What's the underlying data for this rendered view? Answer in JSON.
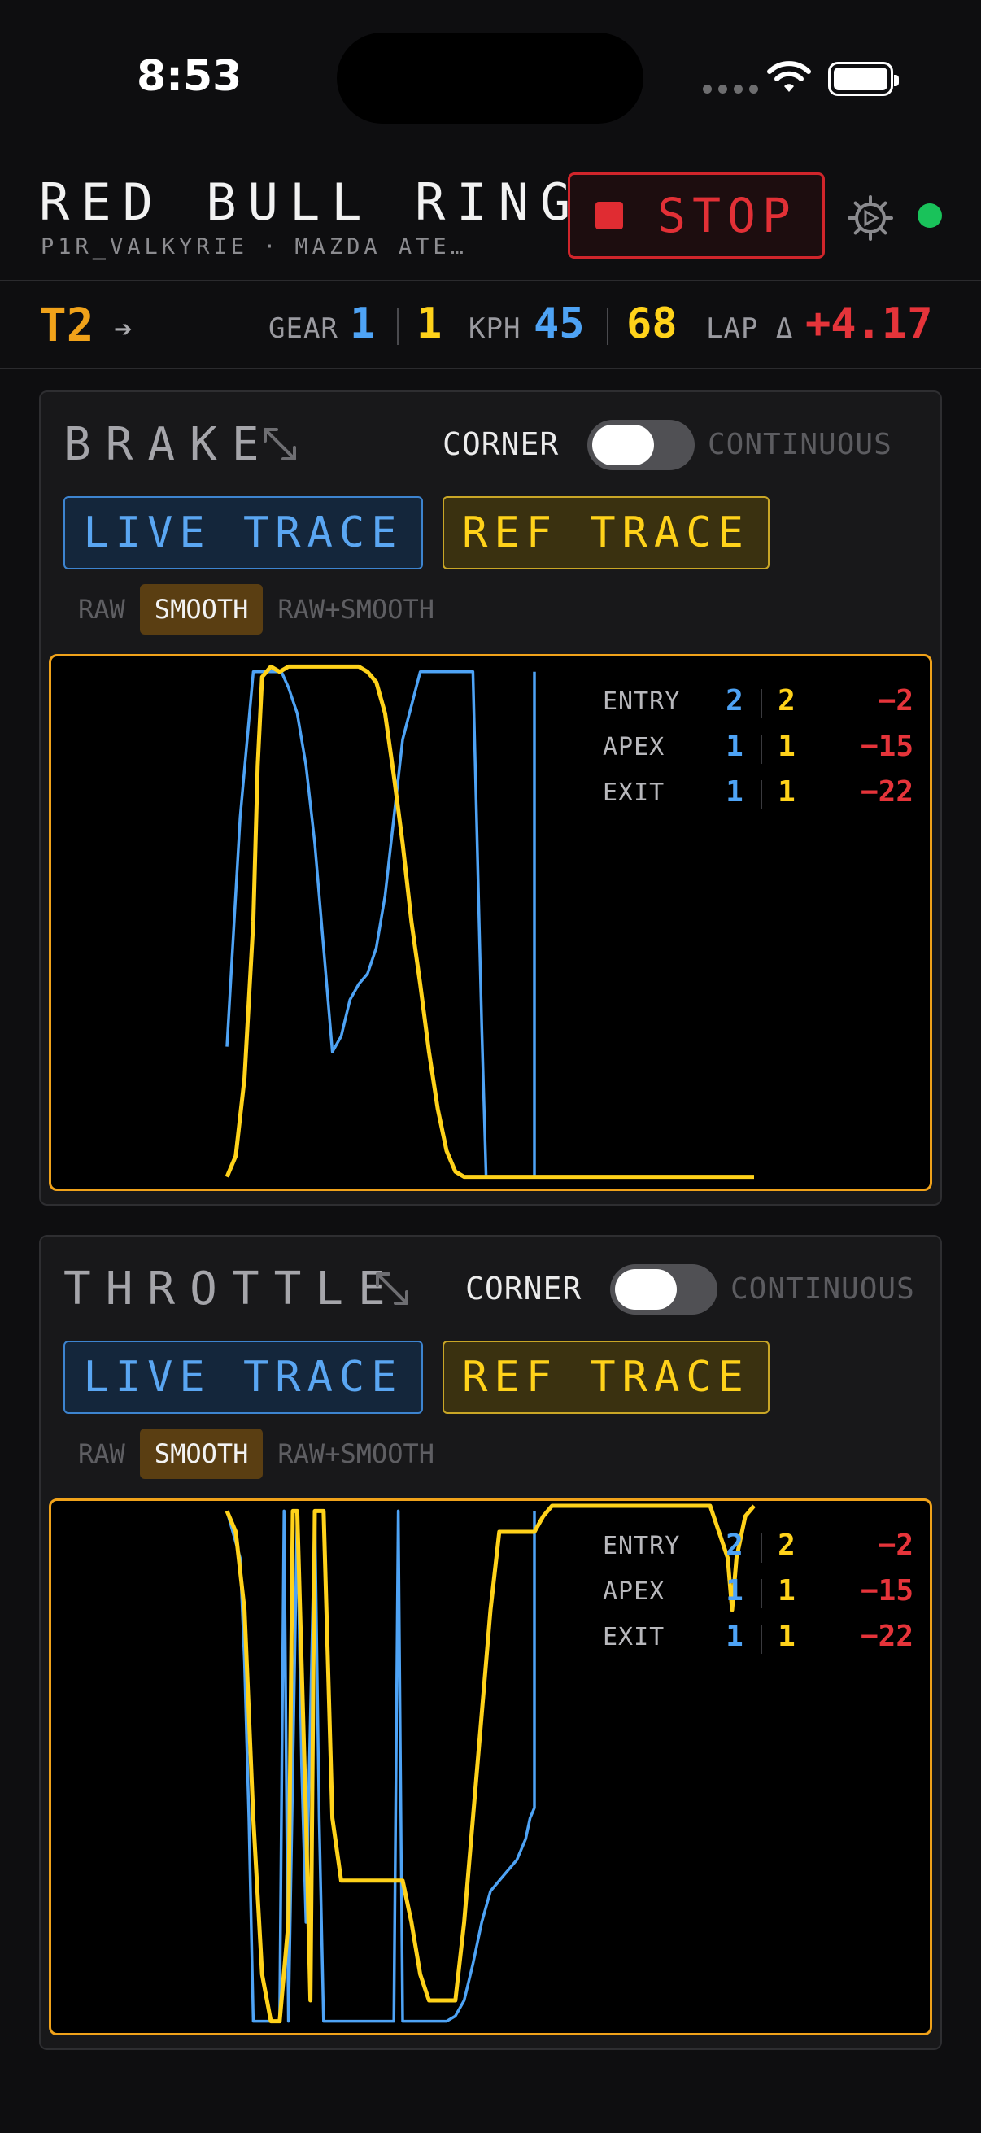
{
  "status": {
    "time": "8:53"
  },
  "header": {
    "track": "RED BULL RING",
    "driver": "P1R_VALKYRIE",
    "separator": "·",
    "car": "MAZDA ATE…",
    "stop_label": "STOP"
  },
  "telemetry": {
    "turn": "T2",
    "turn_arrow": "➔",
    "gear_label": "GEAR",
    "gear_live": "1",
    "gear_ref": "1",
    "kph_label": "KPH",
    "kph_live": "45",
    "kph_ref": "68",
    "lap_label": "LAP Δ",
    "lap_delta": "+4.17"
  },
  "colors": {
    "live": "#4ea3f5",
    "ref": "#ffd21a",
    "delta": "#e5343a",
    "accent": "#f0a21a",
    "connected": "#19c25a"
  },
  "panels": [
    {
      "title": "BRAKE",
      "mode_corner": "CORNER",
      "mode_continuous": "CONTINUOUS",
      "live_trace": "LIVE TRACE",
      "ref_trace": "REF TRACE",
      "smoothing": {
        "options": [
          "RAW",
          "SMOOTH",
          "RAW+SMOOTH"
        ],
        "selected": "SMOOTH"
      },
      "summary": [
        {
          "name": "ENTRY",
          "live": "2",
          "ref": "2",
          "delta": "−2"
        },
        {
          "name": "APEX",
          "live": "1",
          "ref": "1",
          "delta": "−15"
        },
        {
          "name": "EXIT",
          "live": "1",
          "ref": "1",
          "delta": "−22"
        }
      ]
    },
    {
      "title": "THROTTLE",
      "mode_corner": "CORNER",
      "mode_continuous": "CONTINUOUS",
      "live_trace": "LIVE TRACE",
      "ref_trace": "REF TRACE",
      "smoothing": {
        "options": [
          "RAW",
          "SMOOTH",
          "RAW+SMOOTH"
        ],
        "selected": "SMOOTH"
      },
      "summary": [
        {
          "name": "ENTRY",
          "live": "2",
          "ref": "2",
          "delta": "−2"
        },
        {
          "name": "APEX",
          "live": "1",
          "ref": "1",
          "delta": "−15"
        },
        {
          "name": "EXIT",
          "live": "1",
          "ref": "1",
          "delta": "−22"
        }
      ]
    }
  ],
  "chart_data": [
    {
      "type": "line",
      "xlim": [
        0,
        1
      ],
      "ylim": [
        0,
        1
      ],
      "series": [
        {
          "x": [
            0.2,
            0.215,
            0.23,
            0.24,
            0.25,
            0.26,
            0.262,
            0.27,
            0.28,
            0.29,
            0.3,
            0.31,
            0.32,
            0.33,
            0.34,
            0.35,
            0.36,
            0.37,
            0.38,
            0.39,
            0.4,
            0.42,
            0.43,
            0.44,
            0.45,
            0.46,
            0.47,
            0.48,
            0.49,
            0.495,
            0.51,
            0.53,
            0.55,
            0.55
          ],
          "y": [
            0.26,
            0.7,
            0.98,
            0.98,
            0.98,
            0.98,
            0.98,
            0.95,
            0.9,
            0.8,
            0.65,
            0.45,
            0.25,
            0.28,
            0.35,
            0.38,
            0.4,
            0.45,
            0.55,
            0.7,
            0.85,
            0.98,
            0.98,
            0.98,
            0.98,
            0.98,
            0.98,
            0.98,
            0.3,
            0.01,
            0.01,
            0.01,
            0.01,
            0.98
          ]
        },
        {
          "x": [
            0.2,
            0.21,
            0.22,
            0.23,
            0.235,
            0.24,
            0.25,
            0.26,
            0.27,
            0.28,
            0.3,
            0.32,
            0.34,
            0.35,
            0.36,
            0.37,
            0.38,
            0.39,
            0.4,
            0.41,
            0.42,
            0.43,
            0.44,
            0.45,
            0.46,
            0.47,
            0.48,
            0.49,
            0.5,
            0.55,
            0.65,
            0.8
          ],
          "y": [
            0.01,
            0.05,
            0.2,
            0.5,
            0.8,
            0.97,
            0.99,
            0.98,
            0.99,
            0.99,
            0.99,
            0.99,
            0.99,
            0.99,
            0.98,
            0.96,
            0.9,
            0.78,
            0.65,
            0.5,
            0.38,
            0.25,
            0.14,
            0.06,
            0.02,
            0.01,
            0.01,
            0.01,
            0.01,
            0.01,
            0.01,
            0.01
          ]
        }
      ]
    },
    {
      "type": "line",
      "xlim": [
        0,
        1
      ],
      "ylim": [
        0,
        1
      ],
      "series": [
        {
          "x": [
            0.2,
            0.215,
            0.22,
            0.225,
            0.23,
            0.26,
            0.265,
            0.27,
            0.28,
            0.285,
            0.29,
            0.3,
            0.305,
            0.31,
            0.39,
            0.395,
            0.4,
            0.41,
            0.42,
            0.43,
            0.44,
            0.45,
            0.46,
            0.47,
            0.48,
            0.49,
            0.5,
            0.51,
            0.52,
            0.53,
            0.54,
            0.545,
            0.55,
            0.55
          ],
          "y": [
            0.99,
            0.9,
            0.7,
            0.4,
            0.01,
            0.01,
            0.99,
            0.01,
            0.99,
            0.5,
            0.2,
            0.99,
            0.4,
            0.01,
            0.01,
            0.99,
            0.01,
            0.01,
            0.01,
            0.01,
            0.01,
            0.01,
            0.02,
            0.05,
            0.12,
            0.2,
            0.26,
            0.28,
            0.3,
            0.32,
            0.36,
            0.4,
            0.42,
            0.99
          ]
        },
        {
          "x": [
            0.2,
            0.21,
            0.22,
            0.23,
            0.24,
            0.25,
            0.26,
            0.27,
            0.275,
            0.28,
            0.29,
            0.295,
            0.3,
            0.31,
            0.32,
            0.33,
            0.34,
            0.35,
            0.36,
            0.37,
            0.38,
            0.39,
            0.4,
            0.41,
            0.42,
            0.43,
            0.44,
            0.45,
            0.46,
            0.47,
            0.48,
            0.49,
            0.5,
            0.51,
            0.52,
            0.53,
            0.54,
            0.55,
            0.56,
            0.57,
            0.58,
            0.6,
            0.65,
            0.7,
            0.75,
            0.76,
            0.77,
            0.775,
            0.78,
            0.79,
            0.8
          ],
          "y": [
            0.99,
            0.95,
            0.8,
            0.4,
            0.1,
            0.01,
            0.01,
            0.2,
            0.99,
            0.99,
            0.4,
            0.05,
            0.99,
            0.99,
            0.4,
            0.28,
            0.28,
            0.28,
            0.28,
            0.28,
            0.28,
            0.28,
            0.28,
            0.2,
            0.1,
            0.05,
            0.05,
            0.05,
            0.05,
            0.2,
            0.4,
            0.6,
            0.8,
            0.95,
            0.95,
            0.95,
            0.95,
            0.95,
            0.98,
            1.0,
            1.0,
            1.0,
            1.0,
            1.0,
            1.0,
            0.95,
            0.9,
            0.8,
            0.9,
            0.98,
            1.0
          ]
        }
      ]
    }
  ]
}
